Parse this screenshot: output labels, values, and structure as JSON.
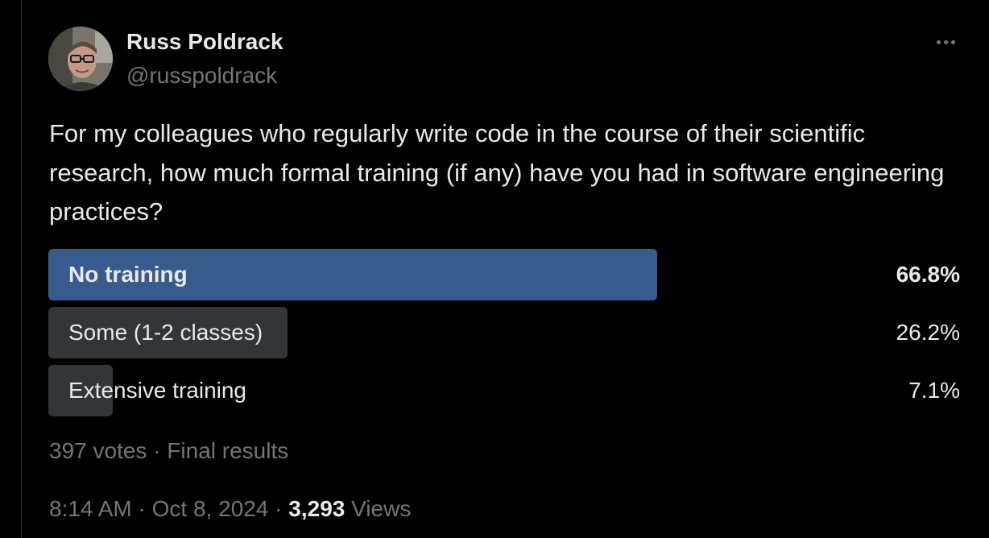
{
  "author": {
    "display_name": "Russ Poldrack",
    "handle": "@russpoldrack"
  },
  "tweet": {
    "text": "For my colleagues who regularly write code in the course of their scientific research, how much formal training (if any) have you had in software engineering practices?"
  },
  "poll": {
    "options": [
      {
        "label": "No training",
        "percent_text": "66.8%",
        "percent": 66.8,
        "winner": true
      },
      {
        "label": "Some (1-2 classes)",
        "percent_text": "26.2%",
        "percent": 26.2,
        "winner": false
      },
      {
        "label": "Extensive training",
        "percent_text": "7.1%",
        "percent": 7.1,
        "winner": false
      }
    ],
    "votes": "397 votes",
    "separator": " · ",
    "status": "Final results"
  },
  "meta": {
    "time": "8:14 AM",
    "date": "Oct 8, 2024",
    "separator": " · ",
    "views_count": "3,293",
    "views_label": "Views"
  },
  "colors": {
    "background": "#000000",
    "text_primary": "#e7e9ea",
    "text_secondary": "#71767b",
    "poll_winner_bar": "#385b8d",
    "poll_bar": "#333639"
  },
  "icons": {
    "more": "more-horizontal-icon"
  }
}
